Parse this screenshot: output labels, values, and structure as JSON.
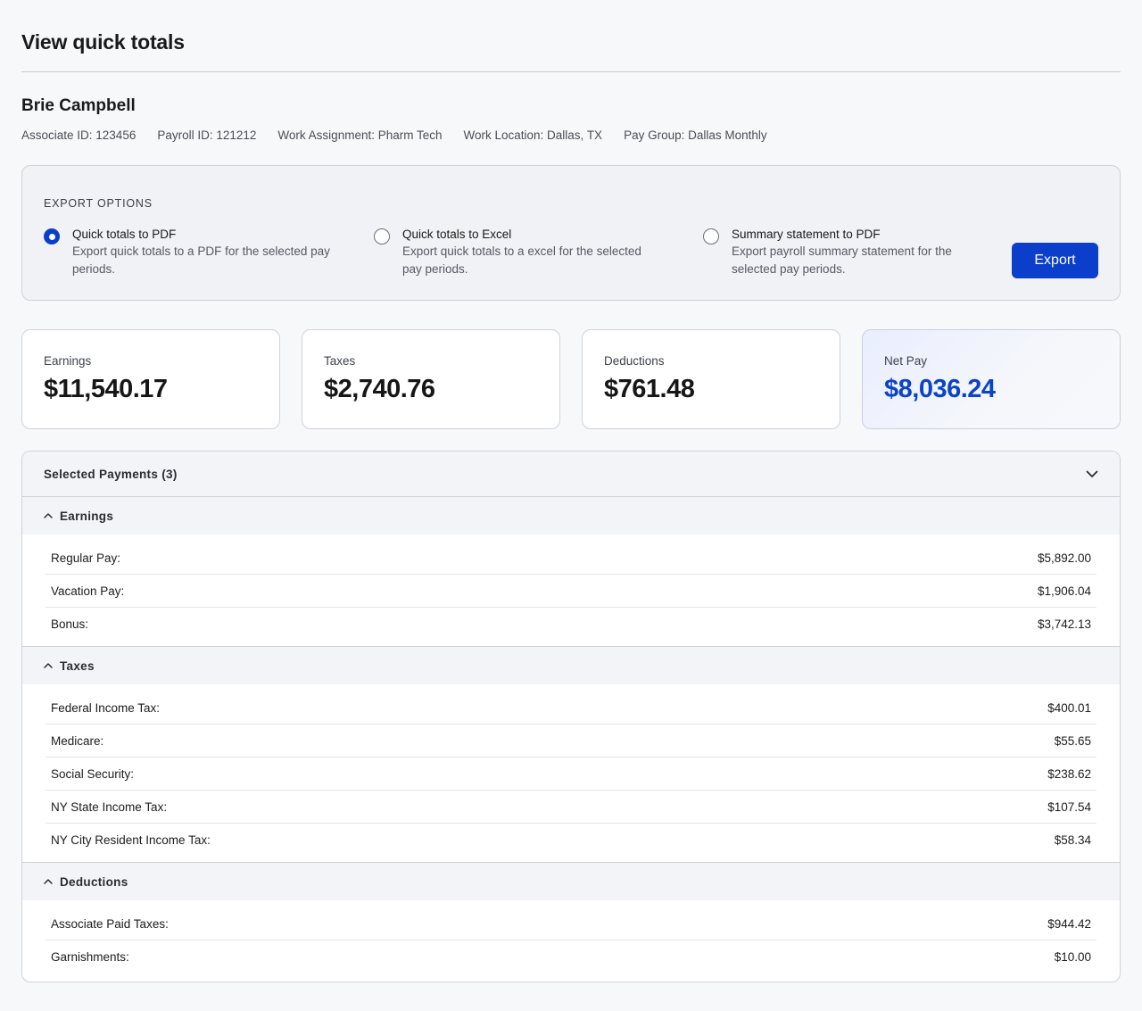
{
  "page_title": "View quick totals",
  "associate": {
    "name": "Brie Campbell",
    "meta": [
      "Associate ID: 123456",
      "Payroll ID: 121212",
      "Work Assignment: Pharm Tech",
      "Work Location: Dallas, TX",
      "Pay Group: Dallas Monthly"
    ]
  },
  "export": {
    "heading": "EXPORT OPTIONS",
    "options": [
      {
        "label": "Quick totals to PDF",
        "desc_line1": "Export quick totals to a PDF for the selected pay",
        "desc_line2": "periods.",
        "selected": true
      },
      {
        "label": "Quick totals to Excel",
        "desc_line1": "Export quick totals to a excel for the selected",
        "desc_line2": "pay periods.",
        "selected": false
      },
      {
        "label": "Summary statement to PDF",
        "desc_line1": "Export payroll summary statement for the",
        "desc_line2": "selected pay periods.",
        "selected": false
      }
    ],
    "button_label": "Export",
    "accent_color": "#0b3fcb"
  },
  "cards": [
    {
      "label": "Earnings",
      "value": "$11,540.17"
    },
    {
      "label": "Taxes",
      "value": "$2,740.76"
    },
    {
      "label": "Deductions",
      "value": "$761.48"
    },
    {
      "label": "Net Pay",
      "value": "$8,036.24"
    }
  ],
  "payments": {
    "title": "Selected Payments (3)",
    "sections": [
      {
        "title": "Earnings",
        "rows": [
          {
            "label": "Regular Pay:",
            "value": "$5,892.00"
          },
          {
            "label": "Vacation Pay:",
            "value": "$1,906.04"
          },
          {
            "label": "Bonus:",
            "value": "$3,742.13"
          }
        ]
      },
      {
        "title": "Taxes",
        "rows": [
          {
            "label": "Federal Income Tax:",
            "value": "$400.01"
          },
          {
            "label": "Medicare:",
            "value": "$55.65"
          },
          {
            "label": "Social Security:",
            "value": "$238.62"
          },
          {
            "label": "NY State Income Tax:",
            "value": "$107.54"
          },
          {
            "label": "NY City Resident Income Tax:",
            "value": "$58.34"
          }
        ]
      },
      {
        "title": "Deductions",
        "rows": [
          {
            "label": "Associate Paid Taxes:",
            "value": "$944.42"
          },
          {
            "label": "Garnishments:",
            "value": "$10.00"
          }
        ]
      }
    ]
  }
}
